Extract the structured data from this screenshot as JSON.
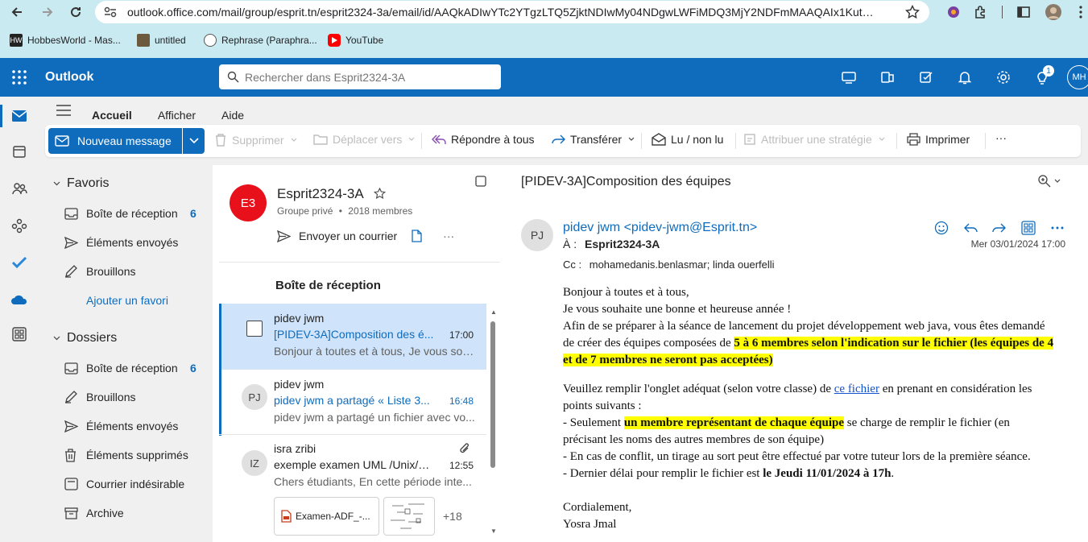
{
  "browser": {
    "url": "outlook.office.com/mail/group/esprit.tn/esprit2324-3a/email/id/AAQkADIwYTc2YTgzLTQ5ZjktNDIwMy04NDgwLWFiMDQ3MjY2NDFmMAAQAIx1KutN%2F...",
    "bookmarks": [
      {
        "label": "HobbesWorld - Mas..."
      },
      {
        "label": "untitled"
      },
      {
        "label": "Rephrase (Paraphra..."
      },
      {
        "label": "YouTube"
      }
    ]
  },
  "header": {
    "app_name": "Outlook",
    "search_placeholder": "Rechercher dans Esprit2324-3A",
    "notification_count": "1",
    "avatar_initials": "MH",
    "accent": "#0f6cbd"
  },
  "ribbon": {
    "tabs": [
      "Accueil",
      "Afficher",
      "Aide"
    ],
    "new_message": "Nouveau message",
    "delete": "Supprimer",
    "move_to": "Déplacer vers",
    "reply_all": "Répondre à tous",
    "forward": "Transférer",
    "read_unread": "Lu / non lu",
    "assign_policy": "Attribuer une stratégie",
    "print": "Imprimer",
    "more": "···"
  },
  "folders": {
    "favorites_title": "Favoris",
    "favorites": [
      {
        "label": "Boîte de réception",
        "count": "6",
        "icon": "inbox-icon"
      },
      {
        "label": "Éléments envoyés",
        "count": "",
        "icon": "sent-icon"
      },
      {
        "label": "Brouillons",
        "count": "",
        "icon": "drafts-icon"
      }
    ],
    "add_favorite": "Ajouter un favori",
    "folders_title": "Dossiers",
    "items": [
      {
        "label": "Boîte de réception",
        "count": "6",
        "icon": "inbox-icon"
      },
      {
        "label": "Brouillons",
        "count": "",
        "icon": "drafts-icon"
      },
      {
        "label": "Éléments envoyés",
        "count": "",
        "icon": "sent-icon"
      },
      {
        "label": "Éléments supprimés",
        "count": "",
        "icon": "trash-icon"
      },
      {
        "label": "Courrier indésirable",
        "count": "",
        "icon": "junk-icon"
      },
      {
        "label": "Archive",
        "count": "",
        "icon": "archive-icon"
      }
    ]
  },
  "group": {
    "initials": "E3",
    "name": "Esprit2324-3A",
    "privacy": "Groupe privé",
    "members": "2018 membres",
    "send_mail": "Envoyer un courrier",
    "more": "···"
  },
  "list": {
    "title": "Boîte de réception",
    "messages": [
      {
        "sender": "pidev jwm",
        "subject": "[PIDEV-3A]Composition des é...",
        "time": "17:00",
        "preview": "Bonjour à toutes et à tous, Je vous sou...",
        "avatar": ""
      },
      {
        "sender": "pidev jwm",
        "subject": "pidev jwm a partagé « Liste 3...",
        "time": "16:48",
        "preview": "pidev jwm a partagé un fichier avec vo...",
        "avatar": "PJ"
      },
      {
        "sender": "isra zribi",
        "subject": "exemple examen UML /Unix/A...",
        "time": "12:55",
        "preview": "Chers étudiants, En cette période inte...",
        "avatar": "IZ"
      }
    ],
    "attachment_name": "Examen-ADF_-...",
    "attachment_more": "+18"
  },
  "reading": {
    "subject": "[PIDEV-3A]Composition des équipes",
    "avatar": "PJ",
    "from": "pidev jwm <pidev-jwm@Esprit.tn>",
    "to_label": "À :",
    "to": "Esprit2324-3A",
    "date": "Mer 03/01/2024 17:00",
    "cc_label": "Cc :",
    "cc": "mohamedanis.benlasmar;   linda ouerfelli",
    "body": {
      "l1": "Bonjour à toutes et à tous,",
      "l2": "Je vous souhaite une bonne et heureuse année !",
      "l3a": "Afin de se préparer à la séance de lancement du projet développement web java, vous êtes demandé de créer des équipes composées de ",
      "l3b": "5 à 6 membres selon l'indication sur le fichier (les équipes de 4 et de 7 membres ne seront pas acceptées)",
      "l4a": "Veuillez remplir l'onglet adéquat (selon votre classe) de ",
      "l4link": "ce fichier",
      "l4b": " en prenant en considération les points suivants :",
      "l5a": "- Seulement ",
      "l5b": "un membre représentant de chaque équipe",
      "l5c": " se charge de remplir le fichier (en précisant les noms des autres membres de son équipe)",
      "l6": "-  En cas de conflit, un tirage au sort peut être effectué par votre tuteur lors de la première séance.",
      "l7a": "-  Dernier délai pour remplir le fichier est ",
      "l7b": "le Jeudi 11/01/2024 à 17h",
      "l7c": ".",
      "l8": "Cordialement,",
      "l9": "Yosra Jmal"
    }
  }
}
